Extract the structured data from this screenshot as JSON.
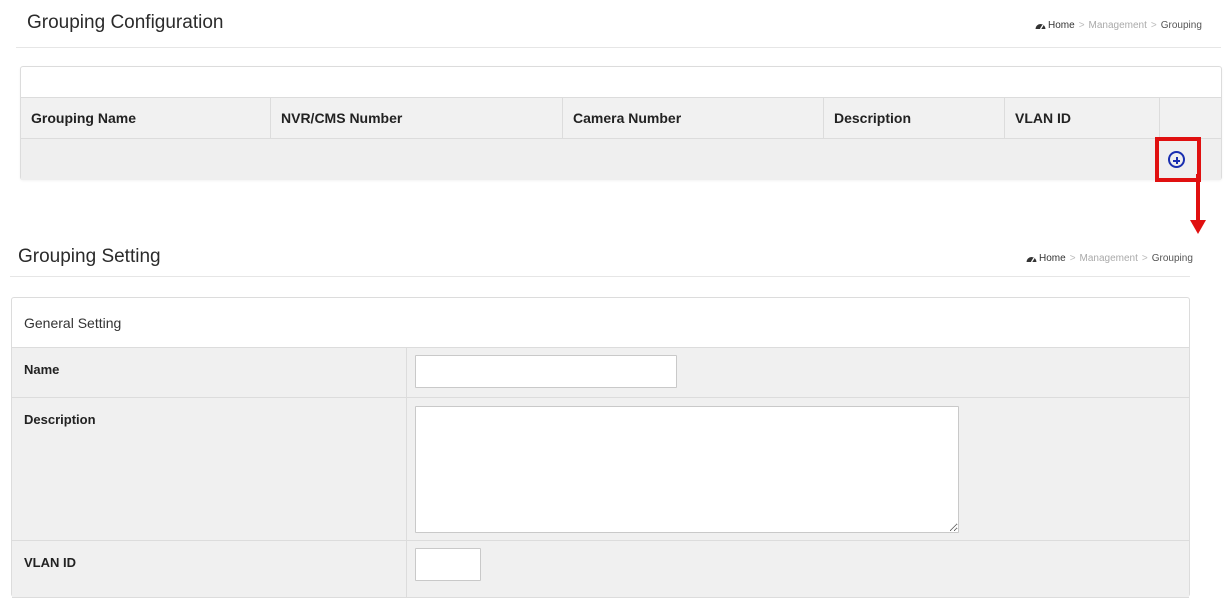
{
  "top": {
    "title": "Grouping Configuration",
    "breadcrumb": {
      "home": "Home",
      "sep1": ">",
      "mid": "Management",
      "sep2": ">",
      "current": "Grouping"
    },
    "table": {
      "columns": [
        "Grouping Name",
        "NVR/CMS Number",
        "Camera Number",
        "Description",
        "VLAN ID"
      ],
      "add_icon": "plus-circle-icon"
    }
  },
  "bottom": {
    "title": "Grouping Setting",
    "breadcrumb": {
      "home": "Home",
      "sep1": ">",
      "mid": "Management",
      "sep2": ">",
      "current": "Grouping"
    },
    "panel_title": "General Setting",
    "fields": {
      "name_label": "Name",
      "name_value": "",
      "description_label": "Description",
      "description_value": "",
      "vlan_label": "VLAN ID",
      "vlan_value": ""
    }
  },
  "colors": {
    "highlight": "#e01010",
    "add_icon": "#1a2fb0",
    "header_bg": "#f1f1f1"
  },
  "icons": {
    "home": "dashboard-icon",
    "add": "plus-circle-icon"
  }
}
